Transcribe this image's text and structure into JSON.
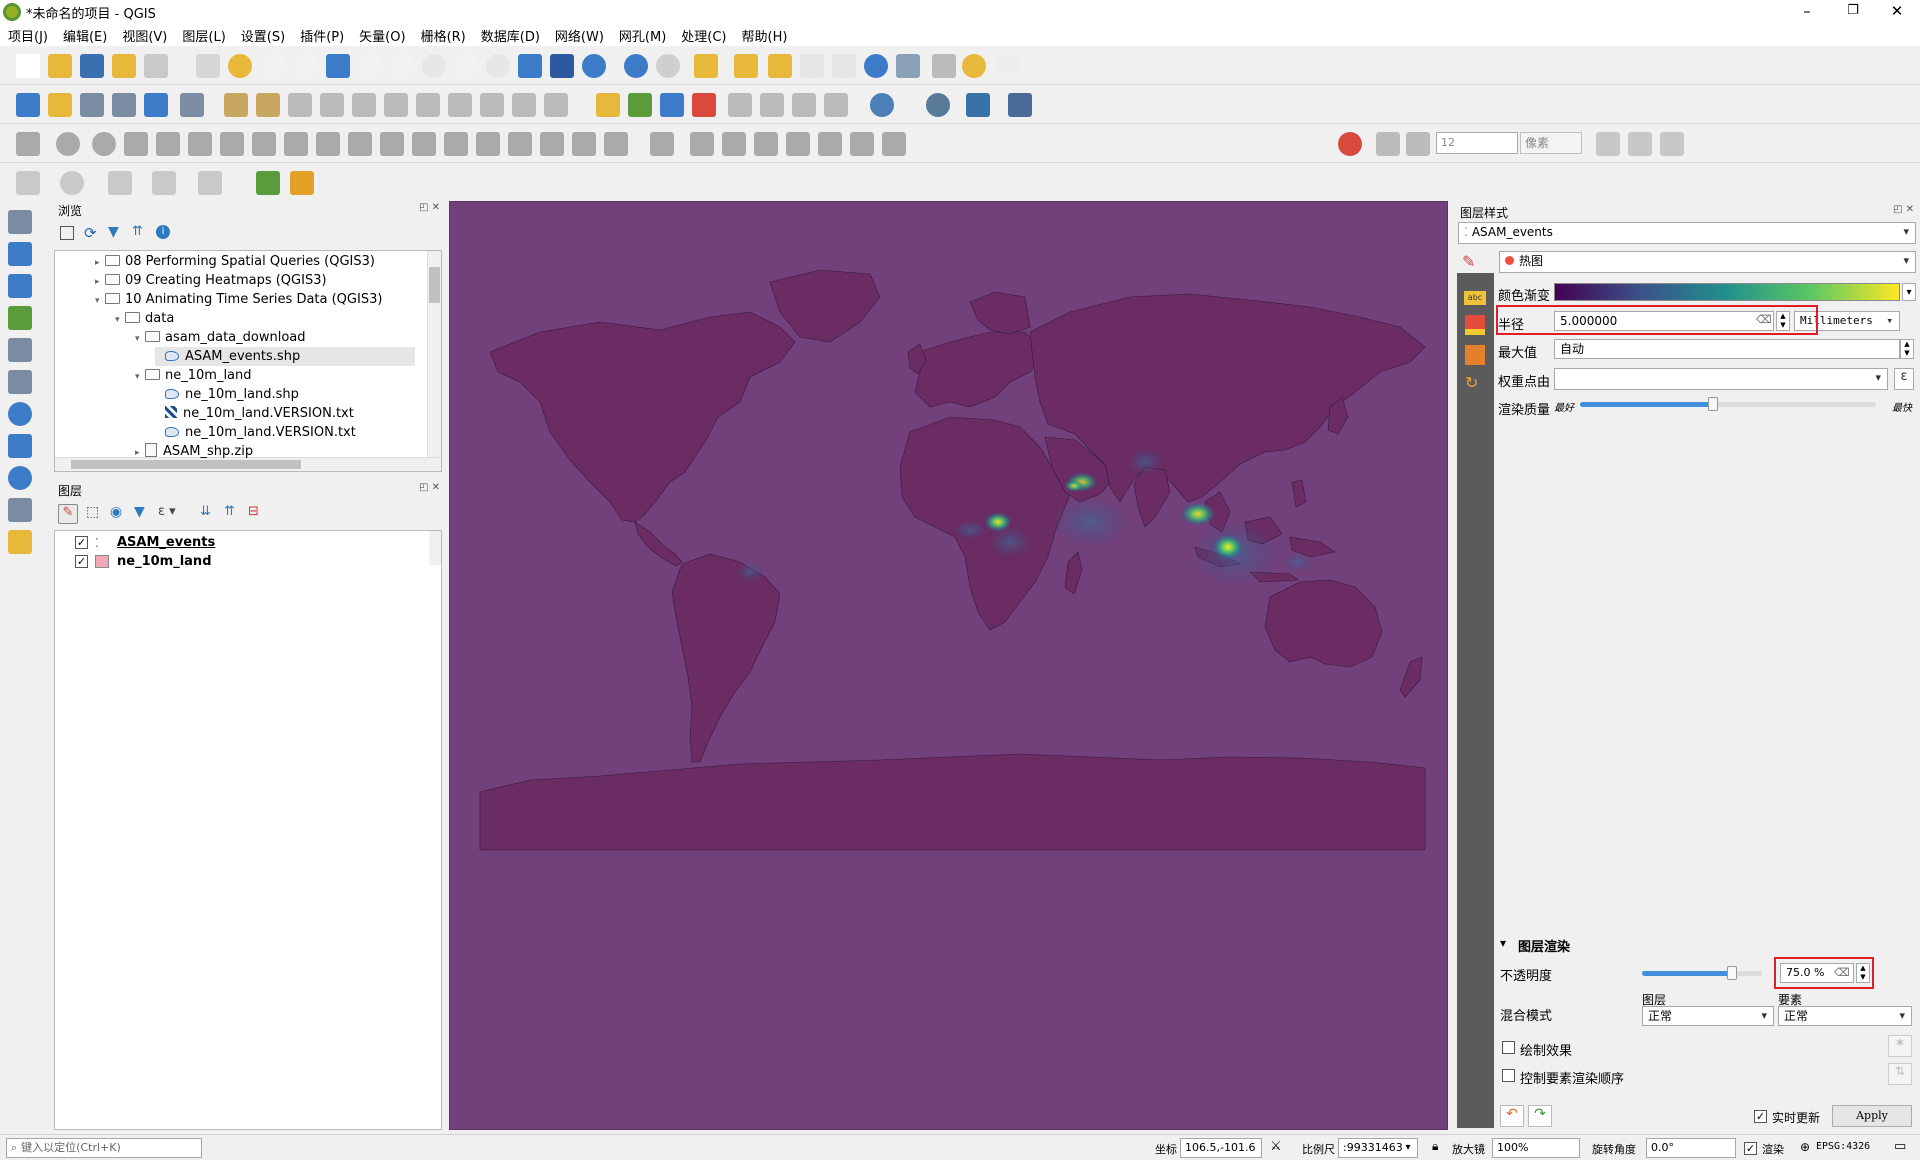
{
  "window": {
    "title": "*未命名的项目 - QGIS",
    "min": "–",
    "restore": "❐",
    "close": "✕"
  },
  "menu": [
    "项目(J)",
    "编辑(E)",
    "视图(V)",
    "图层(L)",
    "设置(S)",
    "插件(P)",
    "矢量(O)",
    "栅格(R)",
    "数据库(D)",
    "网络(W)",
    "网孔(M)",
    "处理(C)",
    "帮助(H)"
  ],
  "toolbar": {
    "snap_tolerance": "12",
    "snap_units": "像素"
  },
  "browser": {
    "title": "浏览",
    "items": [
      {
        "label": "08 Performing Spatial Queries (QGIS3)",
        "kind": "folder",
        "caret": "▸"
      },
      {
        "label": "09 Creating Heatmaps (QGIS3)",
        "kind": "folder",
        "caret": "▸"
      },
      {
        "label": "10 Animating Time Series Data (QGIS3)",
        "kind": "folder",
        "caret": "▾"
      },
      {
        "label": "data",
        "kind": "folder",
        "caret": "▾"
      },
      {
        "label": "asam_data_download",
        "kind": "folder",
        "caret": "▾"
      },
      {
        "label": "ASAM_events.shp",
        "kind": "vector",
        "caret": ""
      },
      {
        "label": "ne_10m_land",
        "kind": "folder",
        "caret": "▾"
      },
      {
        "label": "ne_10m_land.shp",
        "kind": "vector",
        "caret": ""
      },
      {
        "label": "ne_10m_land.VERSION.txt",
        "kind": "raster",
        "caret": ""
      },
      {
        "label": "ne_10m_land.VERSION.txt",
        "kind": "vector",
        "caret": ""
      },
      {
        "label": "ASAM_shp.zip",
        "kind": "zip",
        "caret": "▸"
      }
    ]
  },
  "layers": {
    "title": "图层",
    "items": [
      {
        "label": "ASAM_events",
        "checked": "✓",
        "color": "#ffffff"
      },
      {
        "label": "ne_10m_land",
        "checked": "✓",
        "color": "#f0a8b4"
      }
    ]
  },
  "style_panel": {
    "title": "图层样式",
    "layer": "ASAM_events",
    "renderer": "热图",
    "color_ramp_label": "颜色渐变",
    "radius_label": "半径",
    "radius_value": "5.000000",
    "radius_unit": "Millimeters",
    "max_label": "最大值",
    "max_value": "自动",
    "weight_label": "权重点由",
    "weight_value": "",
    "quality_label": "渲染质量",
    "quality_best": "最好",
    "quality_fast": "最快",
    "quality_level": 0.45,
    "rendering_header": "图层渲染",
    "opacity_label": "不透明度",
    "opacity_value": "75.0 %",
    "opacity_level": 0.75,
    "blend_label": "混合模式",
    "blend_layer_label": "图层",
    "blend_feature_label": "要素",
    "blend_layer_value": "正常",
    "blend_feature_value": "正常",
    "draw_effects": "绘制效果",
    "control_order": "控制要素渲染顺序",
    "live_update": "实时更新",
    "apply": "Apply",
    "ramp_colors": [
      "#440154",
      "#3b528b",
      "#21918c",
      "#5ec962",
      "#fde725"
    ]
  },
  "statusbar": {
    "locator_placeholder": "键入以定位(Ctrl+K)",
    "coord_label": "坐标",
    "coord_value": "106.5,-101.6",
    "scale_label": "比例尺",
    "scale_value": ":99331463",
    "magnifier_label": "放大镜",
    "magnifier_value": "100%",
    "rotation_label": "旋转角度",
    "rotation_value": "0.0°",
    "render_label": "渲染",
    "crs": "EPSG:4326"
  },
  "map": {
    "land_color": "#6a2c62",
    "background": "#72407a"
  }
}
